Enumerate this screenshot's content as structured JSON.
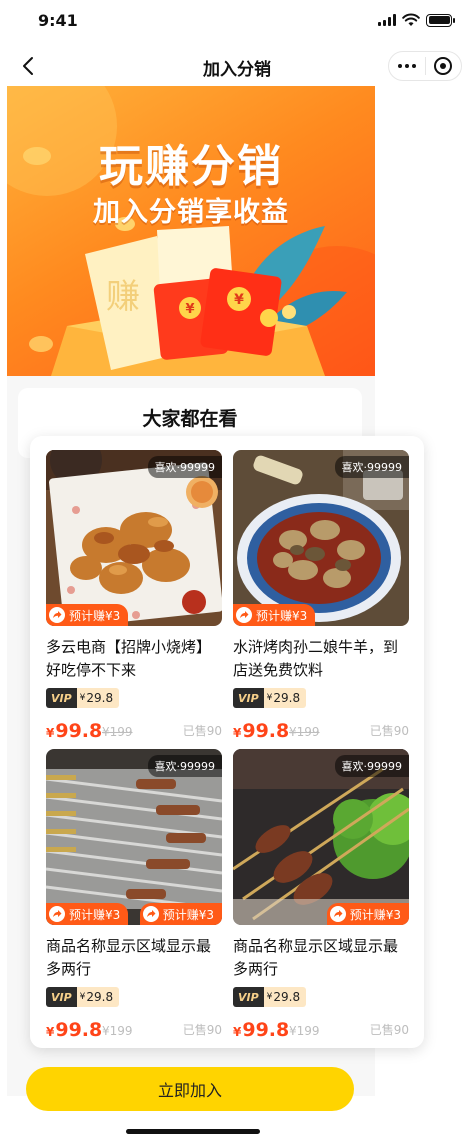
{
  "status_bar": {
    "time": "9:41"
  },
  "nav": {
    "title": "加入分销"
  },
  "banner": {
    "title": "玩赚分销",
    "subtitle": "加入分销享收益",
    "art_text": "赚",
    "coin_symbol": "¥"
  },
  "section": {
    "title": "大家都在看"
  },
  "products": [
    {
      "name": "多云电商【招牌小烧烤】好吃停不下来",
      "likes": "喜欢·99999",
      "earn": "预计赚¥3",
      "vip_label": "VIP",
      "vip_currency": "¥",
      "vip_price": "29.8",
      "currency": "¥",
      "price": "99.8",
      "original_price": "¥199",
      "sold": "已售90"
    },
    {
      "name": "水浒烤肉孙二娘牛羊，到店送免费饮料",
      "likes": "喜欢·99999",
      "earn": "预计赚¥3",
      "vip_label": "VIP",
      "vip_currency": "¥",
      "vip_price": "29.8",
      "currency": "¥",
      "price": "99.8",
      "original_price": "¥199",
      "sold": "已售90"
    },
    {
      "name": "商品名称显示区域显示最多两行",
      "likes": "喜欢·99999",
      "earn": "预计赚¥3",
      "earn_right": "预计赚¥3",
      "vip_label": "VIP",
      "vip_currency": "¥",
      "vip_price": "29.8",
      "currency": "¥",
      "price": "99.8",
      "original_price": "¥199",
      "sold": "已售90"
    },
    {
      "name": "商品名称显示区域显示最多两行",
      "likes": "喜欢·99999",
      "earn": "预计赚¥3",
      "vip_label": "VIP",
      "vip_currency": "¥",
      "vip_price": "29.8",
      "currency": "¥",
      "price": "99.8",
      "original_price": "¥199",
      "sold": "已售90"
    }
  ],
  "cta": {
    "label": "立即加入"
  },
  "colors": {
    "accent": "#ffd400",
    "price": "#ff4418",
    "earn_tag": "#ff5a17",
    "banner": "#ff8a1f"
  },
  "icons": [
    "back-arrow-icon",
    "more-icon",
    "close-circle-icon",
    "share-arrow-icon"
  ]
}
